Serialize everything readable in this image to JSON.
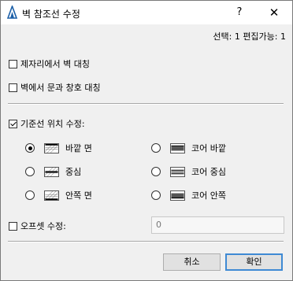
{
  "window": {
    "title": "벽 참조선 수정",
    "help_label": "?",
    "close_label": "✕"
  },
  "selection_info": "선택: 1 편집가능: 1",
  "options": {
    "mirror_in_place": {
      "label": "제자리에서 벽 대칭",
      "checked": false
    },
    "mirror_doors_windows": {
      "label": "벽에서 문과 창호 대칭",
      "checked": false
    },
    "reference_line_position": {
      "label": "기준선 위치 수정:",
      "checked": true
    }
  },
  "positions": [
    {
      "label": "바깥 면",
      "selected": true,
      "icon": "wall-outside-face-icon"
    },
    {
      "label": "중심",
      "selected": false,
      "icon": "wall-center-icon"
    },
    {
      "label": "안쪽 면",
      "selected": false,
      "icon": "wall-inside-face-icon"
    },
    {
      "label": "코어 바깥",
      "selected": false,
      "icon": "core-outside-icon"
    },
    {
      "label": "코어 중심",
      "selected": false,
      "icon": "core-center-icon"
    },
    {
      "label": "코어 안쪽",
      "selected": false,
      "icon": "core-inside-icon"
    }
  ],
  "offset": {
    "label": "오프셋 수정:",
    "checked": false,
    "value": "0"
  },
  "buttons": {
    "cancel": "취소",
    "ok": "확인"
  },
  "colors": {
    "primary_border": "#3f8ad4",
    "dialog_bg": "#f0f0f0"
  }
}
